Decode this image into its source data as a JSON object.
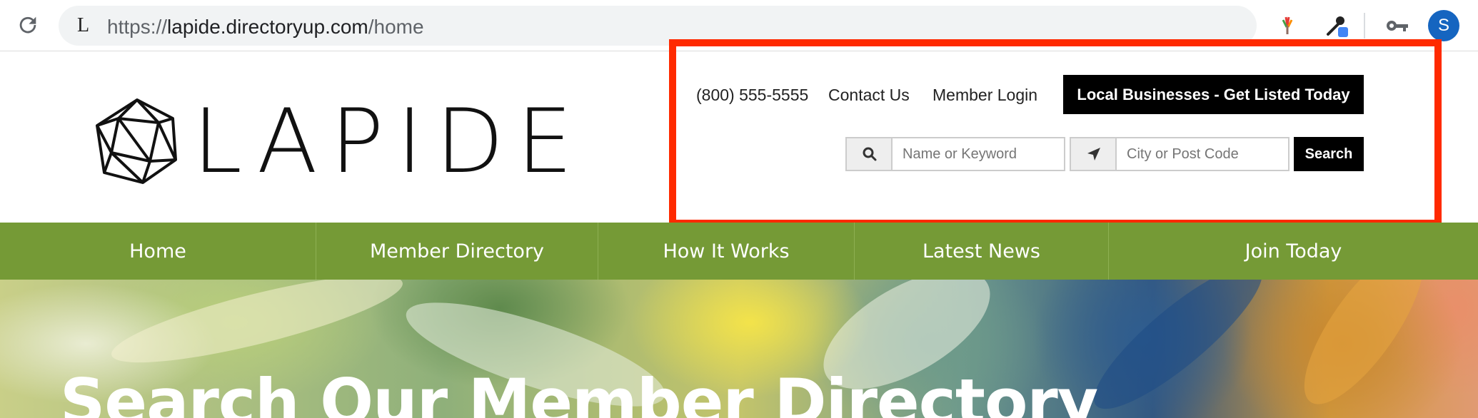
{
  "browser": {
    "favicon_letter": "L",
    "url_prefix": "https://",
    "url_host": "lapide.directoryup.com",
    "url_path": "/home",
    "avatar_letter": "S"
  },
  "header": {
    "logo_text": "LAPIDE",
    "phone": "(800) 555-5555",
    "contact_link": "Contact Us",
    "login_link": "Member Login",
    "cta_button": "Local Businesses - Get Listed Today"
  },
  "search": {
    "keyword_placeholder": "Name or Keyword",
    "location_placeholder": "City or Post Code",
    "button": "Search"
  },
  "nav": {
    "items": [
      {
        "label": "Home"
      },
      {
        "label": "Member Directory"
      },
      {
        "label": "How It Works"
      },
      {
        "label": "Latest News"
      },
      {
        "label": "Join Today"
      }
    ]
  },
  "hero": {
    "title": "Search Our Member Directory"
  },
  "colors": {
    "nav_green": "#759a36",
    "highlight_red": "#ff2a00",
    "cta_black": "#000000",
    "avatar_blue": "#1565c0"
  }
}
